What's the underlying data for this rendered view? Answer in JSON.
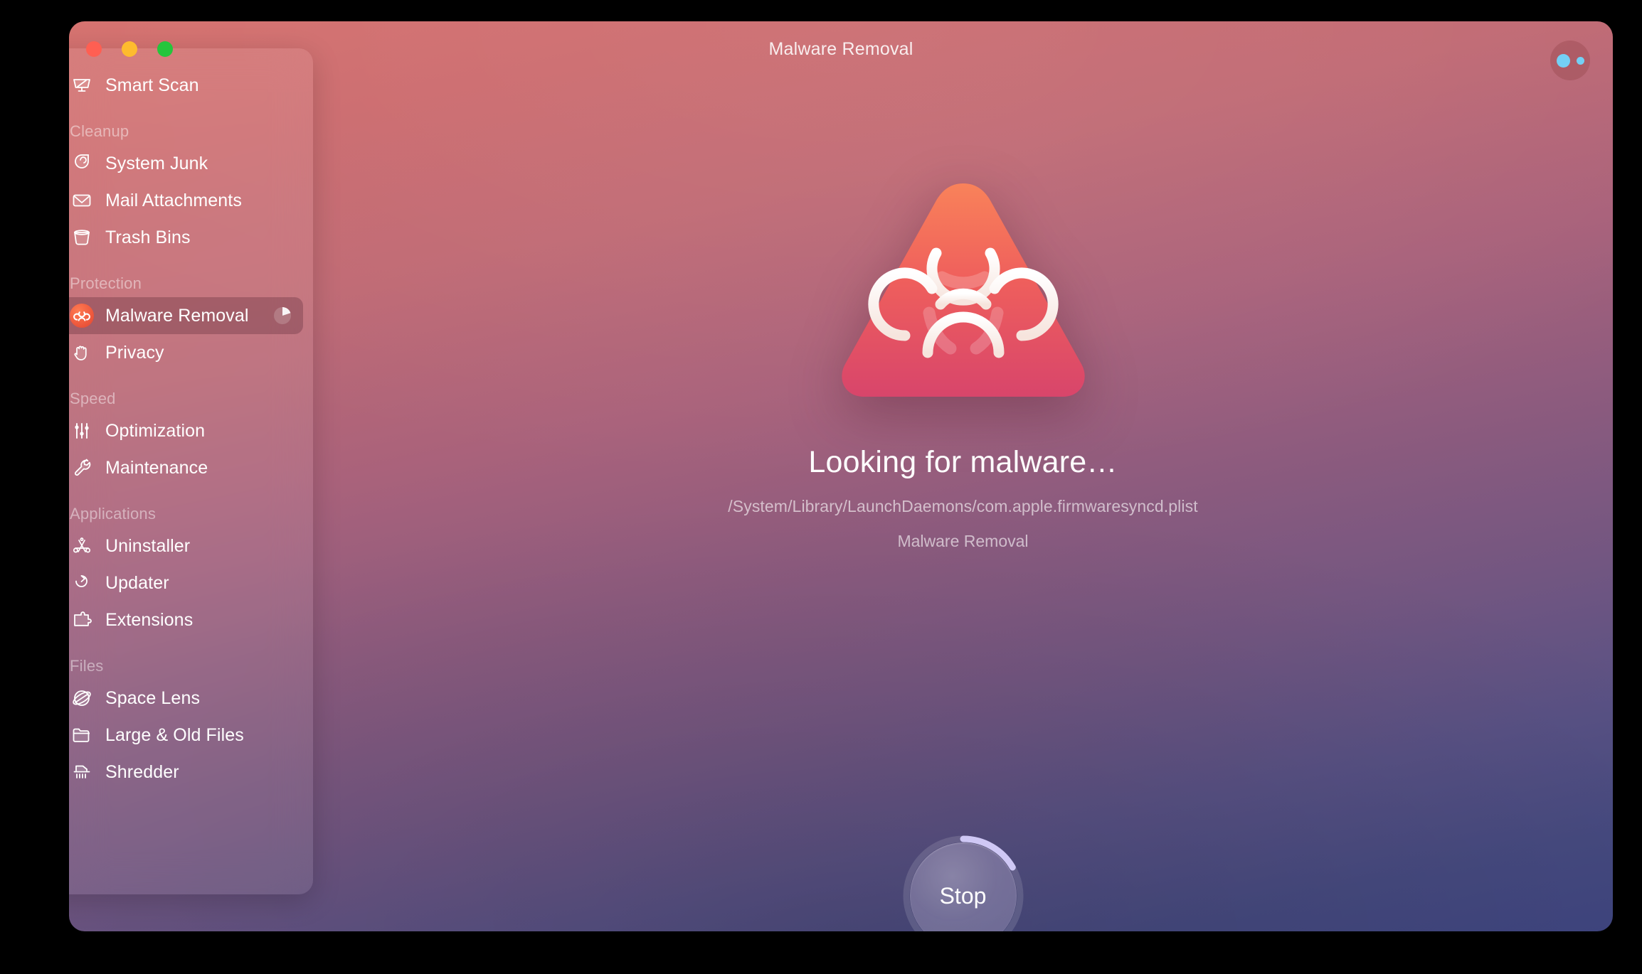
{
  "window": {
    "title": "Malware Removal",
    "traffic_lights": [
      {
        "name": "close",
        "color": "#ff5f52"
      },
      {
        "name": "minimize",
        "color": "#febb2e"
      },
      {
        "name": "maximize",
        "color": "#25c53c"
      }
    ],
    "assistant_button_label": ""
  },
  "sidebar": {
    "top_items": [
      {
        "label": "Smart Scan",
        "icon": "smart-scan-icon"
      }
    ],
    "groups": [
      {
        "title": "Cleanup",
        "items": [
          {
            "label": "System Junk",
            "icon": "system-junk-icon"
          },
          {
            "label": "Mail Attachments",
            "icon": "mail-icon"
          },
          {
            "label": "Trash Bins",
            "icon": "trash-bin-icon"
          }
        ]
      },
      {
        "title": "Protection",
        "items": [
          {
            "label": "Malware Removal",
            "icon": "biohazard-icon",
            "selected": true,
            "progress_badge": 14
          },
          {
            "label": "Privacy",
            "icon": "hand-icon"
          }
        ]
      },
      {
        "title": "Speed",
        "items": [
          {
            "label": "Optimization",
            "icon": "sliders-icon"
          },
          {
            "label": "Maintenance",
            "icon": "wrench-icon"
          }
        ]
      },
      {
        "title": "Applications",
        "items": [
          {
            "label": "Uninstaller",
            "icon": "uninstaller-icon"
          },
          {
            "label": "Updater",
            "icon": "updater-arrow-icon"
          },
          {
            "label": "Extensions",
            "icon": "puzzle-piece-icon"
          }
        ]
      },
      {
        "title": "Files",
        "items": [
          {
            "label": "Space Lens",
            "icon": "space-lens-icon"
          },
          {
            "label": "Large & Old Files",
            "icon": "folder-icon"
          },
          {
            "label": "Shredder",
            "icon": "shredder-icon"
          }
        ]
      }
    ]
  },
  "main": {
    "hero_icon": "biohazard-triangle-icon",
    "status_title": "Looking for malware…",
    "status_path": "/System/Library/LaunchDaemons/com.apple.firmwaresyncd.plist",
    "status_module": "Malware Removal",
    "stop_button_label": "Stop",
    "scan_progress_percent": 15
  },
  "colors": {
    "gradient_top": "#d5716e",
    "gradient_mid": "#8d5b7e",
    "gradient_bottom": "#3f4580",
    "hero_triangle_top": "#f9825a",
    "hero_triangle_bottom": "#d8456b",
    "accent_progress": "#cfc8f5",
    "badge_orange": "#f05c3f"
  }
}
